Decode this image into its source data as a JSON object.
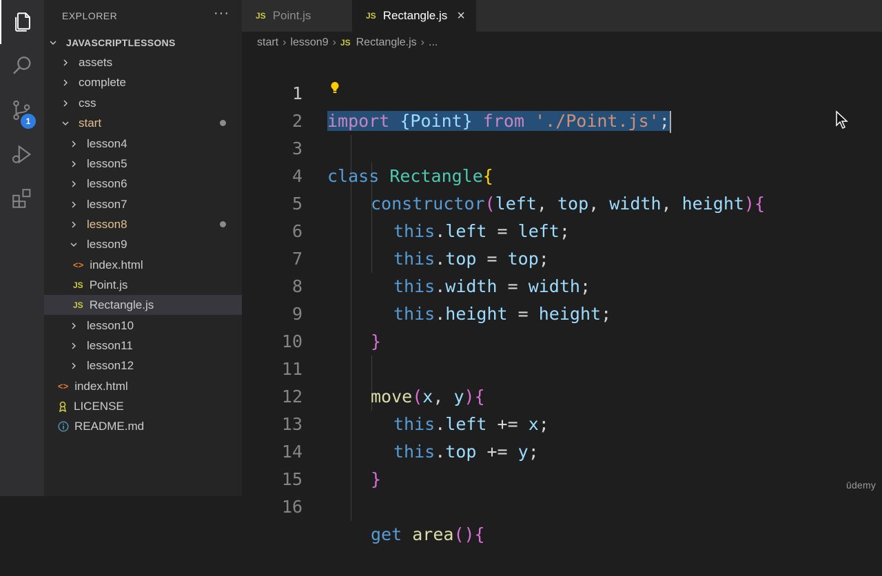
{
  "explorer": {
    "title": "EXPLORER",
    "more": "···",
    "root": "JAVASCRIPTLESSONS",
    "items": [
      {
        "label": "assets"
      },
      {
        "label": "complete"
      },
      {
        "label": "css"
      },
      {
        "label": "start"
      },
      {
        "label": "lesson4"
      },
      {
        "label": "lesson5"
      },
      {
        "label": "lesson6"
      },
      {
        "label": "lesson7"
      },
      {
        "label": "lesson8"
      },
      {
        "label": "lesson9"
      },
      {
        "label": "index.html",
        "icon": "<>"
      },
      {
        "label": "Point.js",
        "icon": "JS"
      },
      {
        "label": "Rectangle.js",
        "icon": "JS"
      },
      {
        "label": "lesson10"
      },
      {
        "label": "lesson11"
      },
      {
        "label": "lesson12"
      },
      {
        "label": "index.html",
        "icon": "<>"
      },
      {
        "label": "LICENSE",
        "icon": "license-icon"
      },
      {
        "label": "README.md",
        "icon": "info-icon"
      }
    ]
  },
  "activity": {
    "scm_badge": "1"
  },
  "tabs": [
    {
      "icon": "JS",
      "label": "Point.js"
    },
    {
      "icon": "JS",
      "label": "Rectangle.js",
      "close": "×"
    }
  ],
  "breadcrumb": {
    "parts": [
      "start",
      "lesson9",
      "Rectangle.js",
      "..."
    ],
    "sep": "›",
    "icon": "JS"
  },
  "editor": {
    "line_numbers": [
      "1",
      "2",
      "3",
      "4",
      "5",
      "6",
      "7",
      "8",
      "9",
      "10",
      "11",
      "12",
      "13",
      "14",
      "15",
      "16"
    ],
    "tokens": {
      "import": "import",
      "point": "{Point}",
      "from": "from",
      "path": "'./Point.js'",
      "semi": ";",
      "class": "class",
      "rectangle": "Rectangle",
      "ob": "{",
      "constructor": "constructor",
      "params": [
        "left",
        "top",
        "width",
        "height"
      ],
      "this": "this",
      "eq": " = ",
      "pluseq": " += ",
      "cb": "}",
      "move": "move",
      "x": "x",
      "y": "y",
      "get": "get",
      "area": "area"
    }
  },
  "watermark": "ūdemy",
  "colors": {
    "keyword_import": "#c586c0",
    "keyword": "#569cd6",
    "class_name": "#4ec9b0",
    "function": "#dcdcaa",
    "variable": "#9cdcfe",
    "string": "#ce9178",
    "selection": "#264f78"
  }
}
